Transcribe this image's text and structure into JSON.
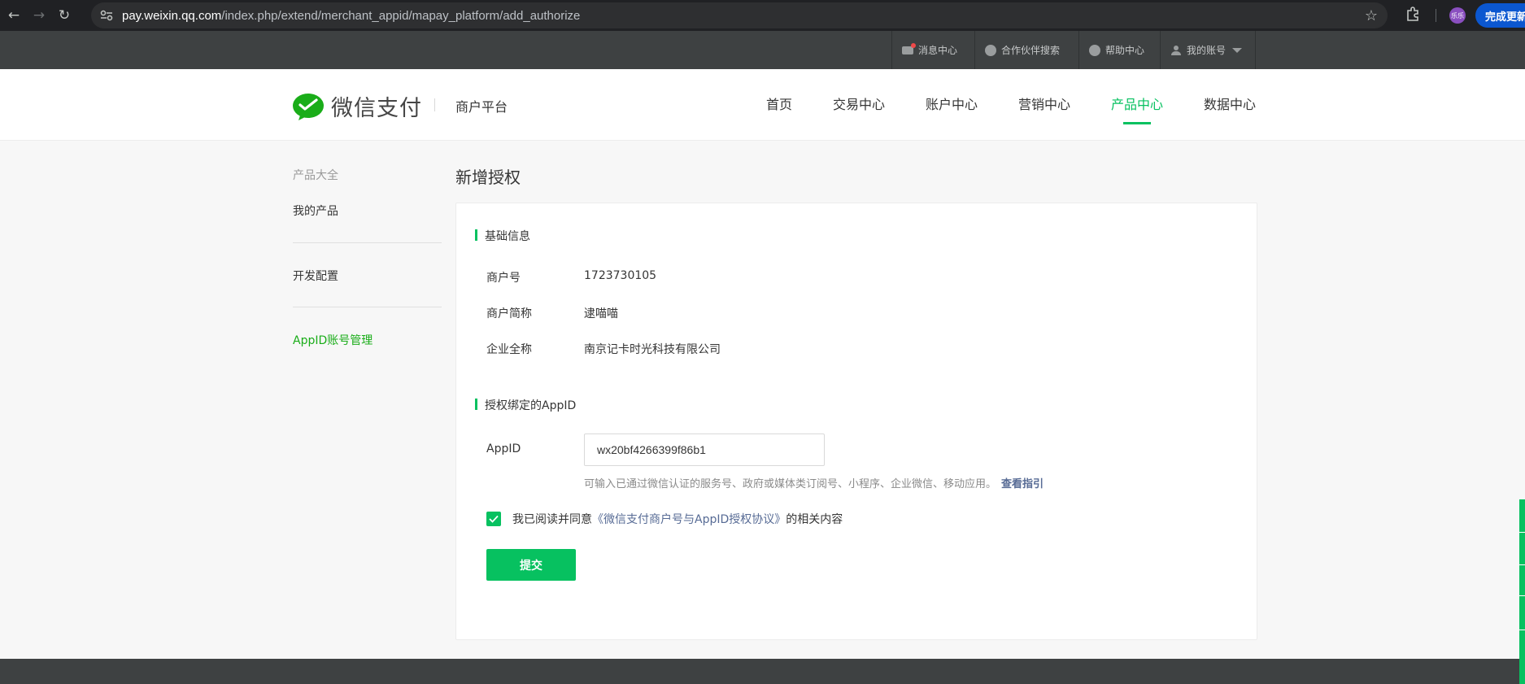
{
  "browser": {
    "url_host": "pay.weixin.qq.com",
    "url_path": "/index.php/extend/merchant_appid/mapay_platform/add_authorize",
    "update_label": "完成更新",
    "profile_label": "乐乐"
  },
  "topbar": {
    "messages": "消息中心",
    "partner_search": "合作伙伴搜索",
    "help": "帮助中心",
    "account": "我的账号"
  },
  "header": {
    "logo_text": "微信支付",
    "platform": "商户平台",
    "nav": [
      "首页",
      "交易中心",
      "账户中心",
      "营销中心",
      "产品中心",
      "数据中心"
    ],
    "active_nav": "产品中心"
  },
  "sidebar": {
    "section_title": "产品大全",
    "items": [
      "我的产品",
      "开发配置",
      "AppID账号管理"
    ],
    "active_item": "AppID账号管理"
  },
  "content": {
    "page_title": "新增授权",
    "basic_info": {
      "heading": "基础信息",
      "merchant_id_label": "商户号",
      "merchant_id": "1723730105",
      "short_name_label": "商户简称",
      "short_name": "逮喵喵",
      "full_name_label": "企业全称",
      "full_name": "南京记卡时光科技有限公司"
    },
    "bind": {
      "heading": "授权绑定的AppID",
      "appid_label": "AppID",
      "appid_value": "wx20bf4266399f86b1",
      "hint": "可输入已通过微信认证的服务号、政府或媒体类订阅号、小程序、企业微信、移动应用。",
      "hint_link": "查看指引"
    },
    "agreement": {
      "prefix": "我已阅读并同意",
      "link": "《微信支付商户号与AppID授权协议》",
      "suffix": "的相关内容",
      "checked": true
    },
    "submit_label": "提交"
  },
  "colors": {
    "accent": "#07c160",
    "link": "#576b95"
  }
}
